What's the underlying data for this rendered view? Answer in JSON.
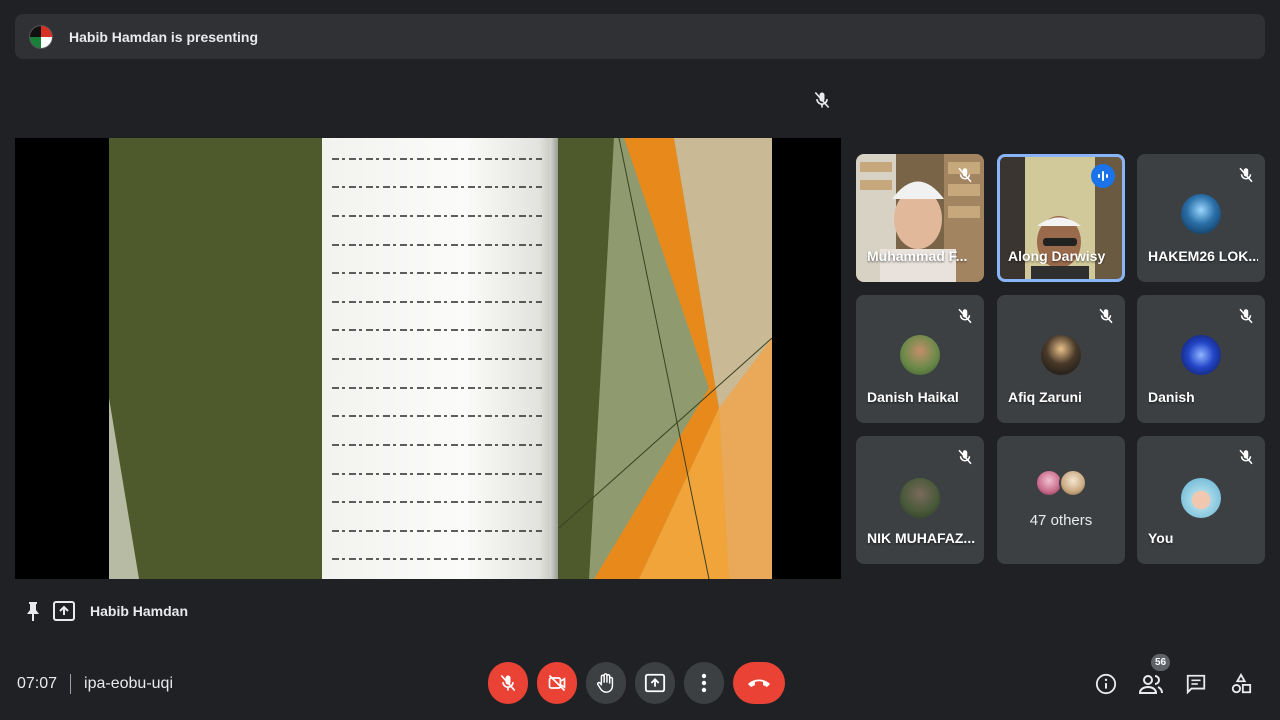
{
  "banner": {
    "presenting_text": "Habib Hamdan is presenting"
  },
  "participants": [
    {
      "name": "Muhammad F...",
      "muted": true,
      "speaking": false
    },
    {
      "name": "Along Darwisy",
      "muted": false,
      "speaking": true
    },
    {
      "name": "HAKEM26 LOK...",
      "muted": true,
      "speaking": false
    },
    {
      "name": "Danish Haikal",
      "muted": true,
      "speaking": false
    },
    {
      "name": "Afiq Zaruni",
      "muted": true,
      "speaking": false
    },
    {
      "name": "Danish",
      "muted": true,
      "speaking": false
    },
    {
      "name": "NIK MUHAFAZ...",
      "muted": true,
      "speaking": false
    },
    {
      "name": "You",
      "muted": true,
      "speaking": false
    }
  ],
  "others_tile": {
    "label": "47 others"
  },
  "presenter": {
    "name": "Habib Hamdan"
  },
  "meeting": {
    "time": "07:07",
    "code": "ipa-eobu-uqi"
  },
  "controls": {
    "mic": "mic-off-icon",
    "camera": "camera-off-icon",
    "raise_hand": "hand-icon",
    "present": "present-icon",
    "more": "more-vert-icon",
    "end_call": "call-end-icon"
  },
  "right_panel": {
    "participant_count": "56"
  },
  "colors": {
    "background": "#202124",
    "tile": "#3c4043",
    "danger": "#ea4335",
    "speaking_outline": "#8ab4f8",
    "slide_olive": "#4e5a2b",
    "slide_orange": "#e8891c"
  }
}
